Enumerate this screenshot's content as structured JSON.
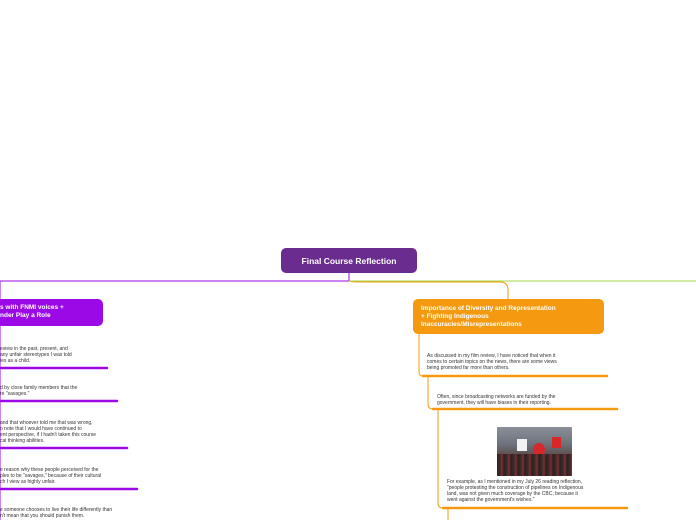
{
  "central": {
    "title": "Final Course Reflection"
  },
  "left_topic": {
    "title_lines": [
      "s with FNMI voices +",
      "nder Play a Role"
    ],
    "notes": [
      {
        "lines": [
          "eview in the past, present, and",
          "any unfair stereotypes I was told",
          "ies as a child."
        ]
      },
      {
        "lines": [
          "d by close family members that the",
          "re \"savages.\""
        ]
      },
      {
        "lines": [
          "and that whoever told me that was wrong,",
          "o note that I would have continued to",
          "ent perspective, if I hadn't taken this course",
          "cal thinking abilities."
        ]
      },
      {
        "lines": [
          "e reason why these people perceived for the",
          "ples to be \"savages,\" because of their cultural",
          "ch I view as highly unfair."
        ]
      },
      {
        "lines": [
          "e someone chooses to live their life differently than",
          "n't mean that you should punish them."
        ]
      }
    ]
  },
  "right_topic": {
    "title_lines": [
      "Importance of Diversity and Representation",
      "+ Fighting Indigenous",
      "Inaccuracies/Misrepresentations"
    ],
    "notes": [
      {
        "lines": [
          "As discussed in my film review, I have noticed that when it",
          "comes to certain topics on the news, there are some views",
          "being promoted far more than others."
        ]
      },
      {
        "lines": [
          "Often, since broadcasting networks are funded by the",
          "government, they will have biases in their reporting."
        ]
      },
      {
        "lines": [
          "For example, as I mentioned in my July 26 reading reflection,",
          "\"people protesting the construction of pipelines on Indigenous",
          "land, was not given much coverage by the CBC, because it",
          "went against the government's wishes.\""
        ]
      }
    ]
  },
  "colors": {
    "central": "#6a2c8f",
    "left_branch": "#9b0ae6",
    "right_branch": "#f59a10",
    "far_right_branch": "#a6d84a"
  }
}
